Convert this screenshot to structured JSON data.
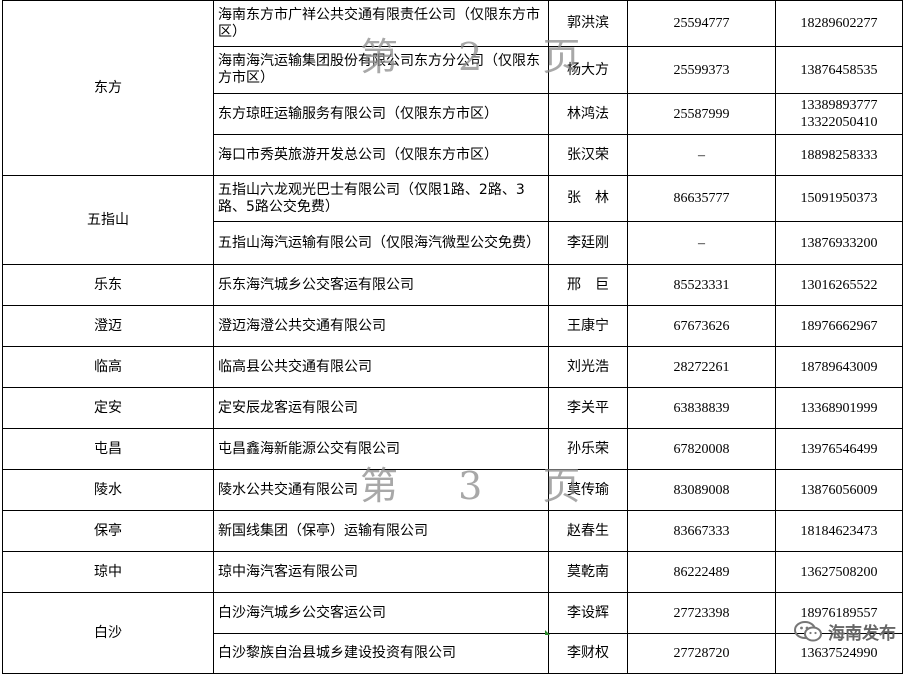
{
  "table": {
    "rows": [
      {
        "region": "东方",
        "rowspan": 4,
        "company": "海南东方市广祥公共交通有限责任公司（仅限东方市区）",
        "contact": "郭洪滨",
        "phone": "25594777",
        "mobile": "18289602277",
        "h": 46
      },
      {
        "company": "海南海汽运输集团股份有限公司东方分公司（仅限东方市区）",
        "contact": "杨大方",
        "phone": "25599373",
        "mobile": "13876458535",
        "h": 47
      },
      {
        "company": "东方琼旺运输服务有限公司（仅限东方市区）",
        "contact": "林鸿法",
        "phone": "25587999",
        "mobile": "13389893777",
        "mobile2": "13322050410",
        "h": 41
      },
      {
        "company": "海口市秀英旅游开发总公司（仅限东方市区）",
        "contact": "张汉荣",
        "phone": "–",
        "mobile": "18898258333",
        "h": 41
      },
      {
        "region": "五指山",
        "rowspan": 2,
        "company": "五指山六龙观光巴士有限公司（仅限1路、2路、3路、5路公交免费）",
        "contact": "张　林",
        "phone": "86635777",
        "mobile": "15091950373",
        "h": 46
      },
      {
        "company": "五指山海汽运输有限公司（仅限海汽微型公交免费）",
        "contact": "李廷刚",
        "phone": "–",
        "mobile": "13876933200",
        "h": 43,
        "pagebreak": true
      },
      {
        "region": "乐东",
        "company": "乐东海汽城乡公交客运有限公司",
        "contact": "邢　巨",
        "phone": "85523331",
        "mobile": "13016265522",
        "h": 41
      },
      {
        "region": "澄迈",
        "company": "澄迈海澄公共交通有限公司",
        "contact": "王康宁",
        "phone": "67673626",
        "mobile": "18976662967",
        "h": 41
      },
      {
        "region": "临高",
        "company": "临高县公共交通有限公司",
        "contact": "刘光浩",
        "phone": "28272261",
        "mobile": "18789643009",
        "h": 41
      },
      {
        "region": "定安",
        "company": "定安辰龙客运有限公司",
        "contact": "李关平",
        "phone": "63838839",
        "mobile": "13368901999",
        "h": 41
      },
      {
        "region": "屯昌",
        "company": "屯昌鑫海新能源公交有限公司",
        "contact": "孙乐荣",
        "phone": "67820008",
        "mobile": "13976546499",
        "h": 41
      },
      {
        "region": "陵水",
        "company": "陵水公共交通有限公司",
        "contact": "莫传瑜",
        "phone": "83089008",
        "mobile": "13876056009",
        "h": 41
      },
      {
        "region": "保亭",
        "company": "新国线集团（保亭）运输有限公司",
        "contact": "赵春生",
        "phone": "83667333",
        "mobile": "18184623473",
        "h": 41
      },
      {
        "region": "琼中",
        "company": "琼中海汽客运有限公司",
        "contact": "莫乾南",
        "phone": "86222489",
        "mobile": "13627508200",
        "h": 41
      },
      {
        "region": "白沙",
        "rowspan": 2,
        "company": "白沙海汽城乡公交客运公司",
        "contact": "李设辉",
        "phone": "27723398",
        "mobile": "18976189557",
        "h": 41
      },
      {
        "company": "白沙黎族自治县城乡建设投资有限公司",
        "contact": "李财权",
        "phone": "27728720",
        "mobile": "13637524990",
        "h": 40
      }
    ]
  },
  "watermarks": {
    "page2": "第 2 页",
    "page3": "第 3 页"
  },
  "wechat": {
    "icon": "wechat-icon",
    "account": "海南发布"
  }
}
